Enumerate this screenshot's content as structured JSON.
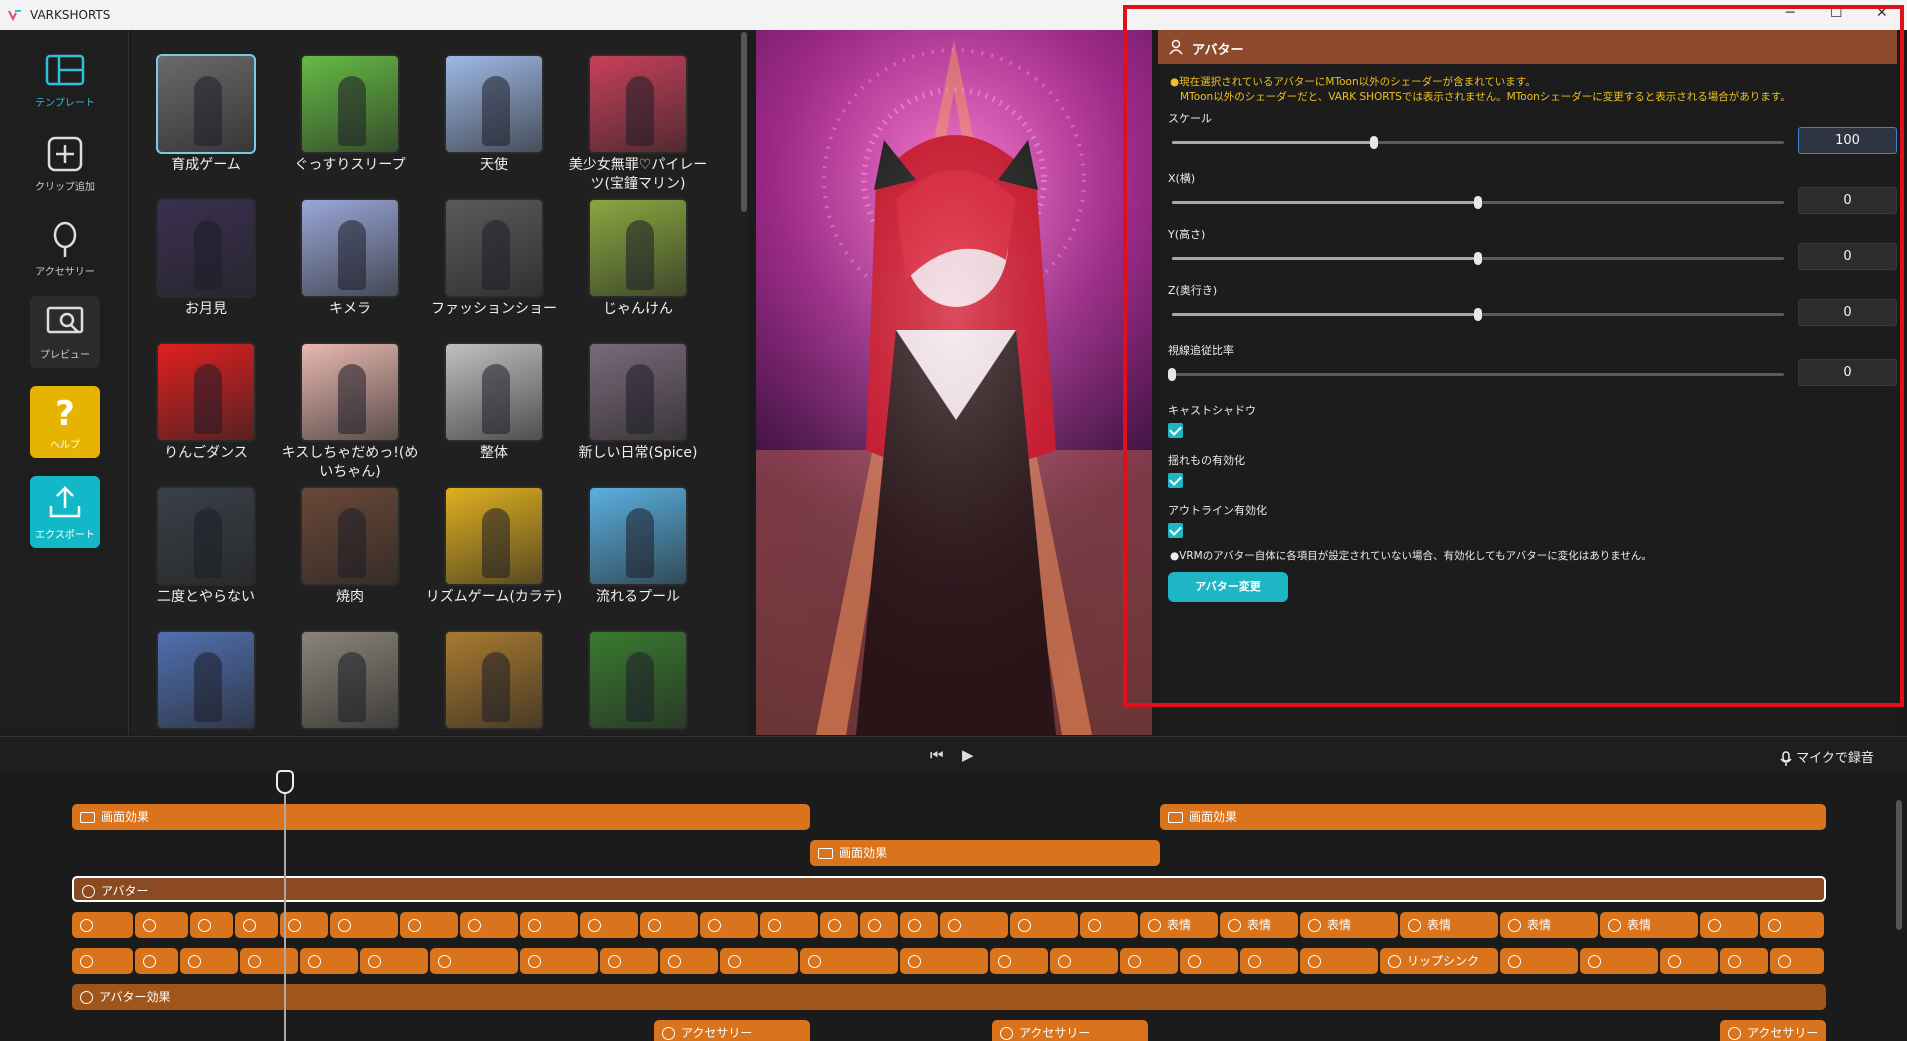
{
  "app": {
    "title": "VARKSHORTS"
  },
  "sidebar": {
    "items": [
      {
        "label": "テンプレート"
      },
      {
        "label": "クリップ追加"
      },
      {
        "label": "アクセサリー"
      },
      {
        "label": "プレビュー"
      },
      {
        "label": "ヘルプ"
      },
      {
        "label": "エクスポート"
      }
    ]
  },
  "templates": [
    {
      "name": "育成ゲーム",
      "color": "#6a6a6a"
    },
    {
      "name": "ぐっすりスリープ",
      "color": "#66bb44"
    },
    {
      "name": "天使",
      "color": "#9fb9e6"
    },
    {
      "name": "美少女無罪♡パイレーツ(宝鐘マリン)",
      "color": "#c8405a"
    },
    {
      "name": "お月見",
      "color": "#3a3050"
    },
    {
      "name": "キメラ",
      "color": "#9aa7d8"
    },
    {
      "name": "ファッションショー",
      "color": "#5a5a5a"
    },
    {
      "name": "じゃんけん",
      "color": "#8aa840"
    },
    {
      "name": "りんごダンス",
      "color": "#e02020"
    },
    {
      "name": "キスしちゃだめっ!(めいちゃん)",
      "color": "#e8b8b0"
    },
    {
      "name": "整体",
      "color": "#c0c0c0"
    },
    {
      "name": "新しい日常(Spice)",
      "color": "#7a6a7a"
    },
    {
      "name": "二度とやらない",
      "color": "#3a4048"
    },
    {
      "name": "焼肉",
      "color": "#6a4838"
    },
    {
      "name": "リズムゲーム(カラテ)",
      "color": "#e0b020"
    },
    {
      "name": "流れるプール",
      "color": "#5ab0e0"
    },
    {
      "name": "",
      "color": "#5070b0"
    },
    {
      "name": "",
      "color": "#8a8478"
    },
    {
      "name": "",
      "color": "#a87a30"
    },
    {
      "name": "",
      "color": "#3a7a30"
    }
  ],
  "panel": {
    "title": "アバター",
    "warning_line1": "●現在選択されているアバターにMToon以外のシェーダーが含まれています。",
    "warning_line2": "MToon以外のシェーダーだと、VARK SHORTSでは表示されません。MToonシェーダーに変更すると表示される場合があります。",
    "sliders": [
      {
        "label": "スケール",
        "value": "100",
        "level": 0.33
      },
      {
        "label": "X(横)",
        "value": "0",
        "level": 0.5
      },
      {
        "label": "Y(高さ)",
        "value": "0",
        "level": 0.5
      },
      {
        "label": "Z(奥行き)",
        "value": "0",
        "level": 0.5
      },
      {
        "label": "視線追従比率",
        "value": "0",
        "level": 0.0
      }
    ],
    "checks": [
      {
        "label": "キャストシャドウ"
      },
      {
        "label": "揺れもの有効化"
      },
      {
        "label": "アウトライン有効化"
      }
    ],
    "note": "●VRMのアバター自体に各項目が設定されていない場合、有効化してもアバターに変化はありません。",
    "change_button": "アバター変更"
  },
  "timeline": {
    "mic_label": "マイクで録音",
    "screen_effect": "画面効果",
    "avatar": "アバター",
    "expression": "表情",
    "lipsync": "リップシンク",
    "avatar_effect": "アバター効果",
    "accessory": "アクセサリー"
  }
}
